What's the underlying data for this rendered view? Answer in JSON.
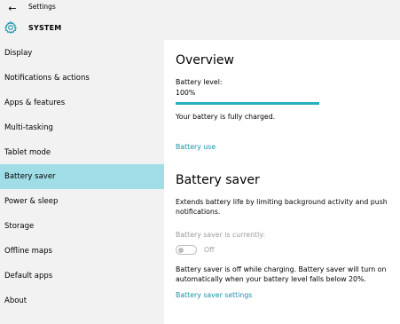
{
  "window": {
    "title": "Settings"
  },
  "header": {
    "section": "SYSTEM"
  },
  "sidebar": {
    "items": [
      {
        "label": "Display"
      },
      {
        "label": "Notifications & actions"
      },
      {
        "label": "Apps & features"
      },
      {
        "label": "Multi-tasking"
      },
      {
        "label": "Tablet mode"
      },
      {
        "label": "Battery saver",
        "active": true
      },
      {
        "label": "Power & sleep"
      },
      {
        "label": "Storage"
      },
      {
        "label": "Offline maps"
      },
      {
        "label": "Default apps"
      },
      {
        "label": "About"
      }
    ]
  },
  "overview": {
    "heading": "Overview",
    "battery_level_label": "Battery level:",
    "battery_level_value": "100%",
    "battery_level_fraction": 1.0,
    "status": "Your battery is fully charged.",
    "battery_use_link": "Battery use"
  },
  "saver": {
    "heading": "Battery saver",
    "description": "Extends battery life by limiting background activity and push notifications.",
    "currently_label": "Battery saver is currently:",
    "toggle_state": "Off",
    "info": "Battery saver is off while charging. Battery saver will turn on automatically when your battery level falls below 20%.",
    "settings_link": "Battery saver settings"
  },
  "colors": {
    "accent": "#1892aa",
    "progress": "#25b0c0",
    "active_nav": "#a0dde6",
    "chrome": "#f2f2f2"
  },
  "icons": {
    "back": "back-arrow-icon",
    "section": "gear-icon"
  }
}
